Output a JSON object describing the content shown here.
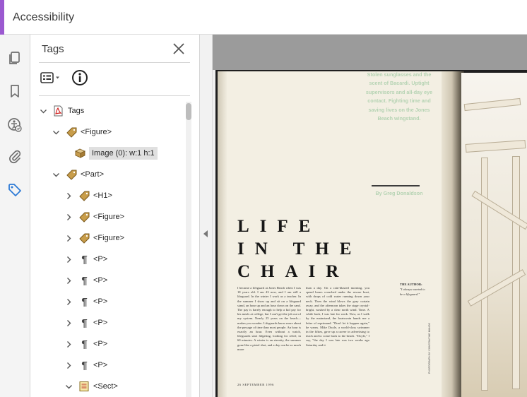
{
  "app": {
    "title": "Accessibility",
    "accent_color": "#9b59d0"
  },
  "rail": {
    "icons": [
      {
        "name": "pages-icon"
      },
      {
        "name": "bookmark-icon"
      },
      {
        "name": "accessibility-checker-icon"
      },
      {
        "name": "attachments-icon"
      },
      {
        "name": "tags-icon",
        "active": true
      }
    ]
  },
  "tags_panel": {
    "title": "Tags",
    "tree": [
      {
        "label": "Tags",
        "icon": "pdf-icon",
        "expanded": true,
        "depth": 0
      },
      {
        "label": "<Figure>",
        "icon": "tag-icon",
        "expanded": true,
        "depth": 1
      },
      {
        "label": "Image (0): w:1 h:1",
        "icon": "image-icon",
        "depth": 2,
        "selected": true
      },
      {
        "label": "<Part>",
        "icon": "tag-icon",
        "expanded": true,
        "depth": 1
      },
      {
        "label": "<H1>",
        "icon": "tag-icon",
        "expanded": false,
        "depth": 2
      },
      {
        "label": "<Figure>",
        "icon": "tag-icon",
        "expanded": false,
        "depth": 2
      },
      {
        "label": "<Figure>",
        "icon": "tag-icon",
        "expanded": false,
        "depth": 2
      },
      {
        "label": "<P>",
        "icon": "paragraph-icon",
        "expanded": false,
        "depth": 2
      },
      {
        "label": "<P>",
        "icon": "paragraph-icon",
        "expanded": false,
        "depth": 2
      },
      {
        "label": "<P>",
        "icon": "paragraph-icon",
        "expanded": false,
        "depth": 2
      },
      {
        "label": "<P>",
        "icon": "paragraph-icon",
        "expanded": false,
        "depth": 2
      },
      {
        "label": "<P>",
        "icon": "paragraph-icon",
        "expanded": false,
        "depth": 2
      },
      {
        "label": "<P>",
        "icon": "paragraph-icon",
        "expanded": false,
        "depth": 2
      },
      {
        "label": "<Sect>",
        "icon": "section-icon",
        "expanded": true,
        "depth": 2
      }
    ]
  },
  "document": {
    "pull_quote": "Stolen sunglasses and the scent of Bacardi. Uptight supervisors and all-day eye contact. Fighting time and saving lives on the Jones Beach wingstand.",
    "byline": "By Greg Donaldson",
    "headline_lines": [
      "LIFE",
      "IN THE",
      "CHAIR"
    ],
    "column1": "I became a lifeguard at Jones Beach when I was 18 years old. I am 43 now, and I am still a lifeguard. In the winter I work as a teacher. In the summer I show up and sit on a lifeguard stand, an hour up and an hour down on the sand. The pay is barely enough to help a kid pay for his meals at college, but I can't get the job out of my system. Nearly 25 years on the beach—makes you wonder. Lifeguards know more about the passage of time than most people. An hour is exactly an hour. Even without a watch, lifeguards start fidgeting, looking for relief, in 60 minutes. A winter is an eternity, the summer gone like a pistol shot, and a day can be so much more",
    "column2": "than a day. On a rain-blasted morning, you spend hours crouched under the rescue boat, with drops of cold water running down your neck. Then the wind blows the gray curtain away, and the afternoon takes the stage crystal-bright, washed by a clear north wind. Time. A while back, I was late for work. Now, as I walk by the mainstand, the boatswain hands me a letter of reprimand. \"Don't let it happen again,\" he warns. Mike Doyle, a world-class swimmer in the fifties, gave up a career in advertising to teach and to come back to the beach. \"Doyle,\" I say, \"the day I was late was two weeks ago Saturday and it",
    "author_label": "THE AUTHOR:",
    "author_quote": "\"I always wanted to be a lifeguard.\"",
    "footer": "26 SEPTEMBER 1996",
    "photo_credit": "PHOTOGRAPH BY CONSTANTINE MANOS"
  }
}
